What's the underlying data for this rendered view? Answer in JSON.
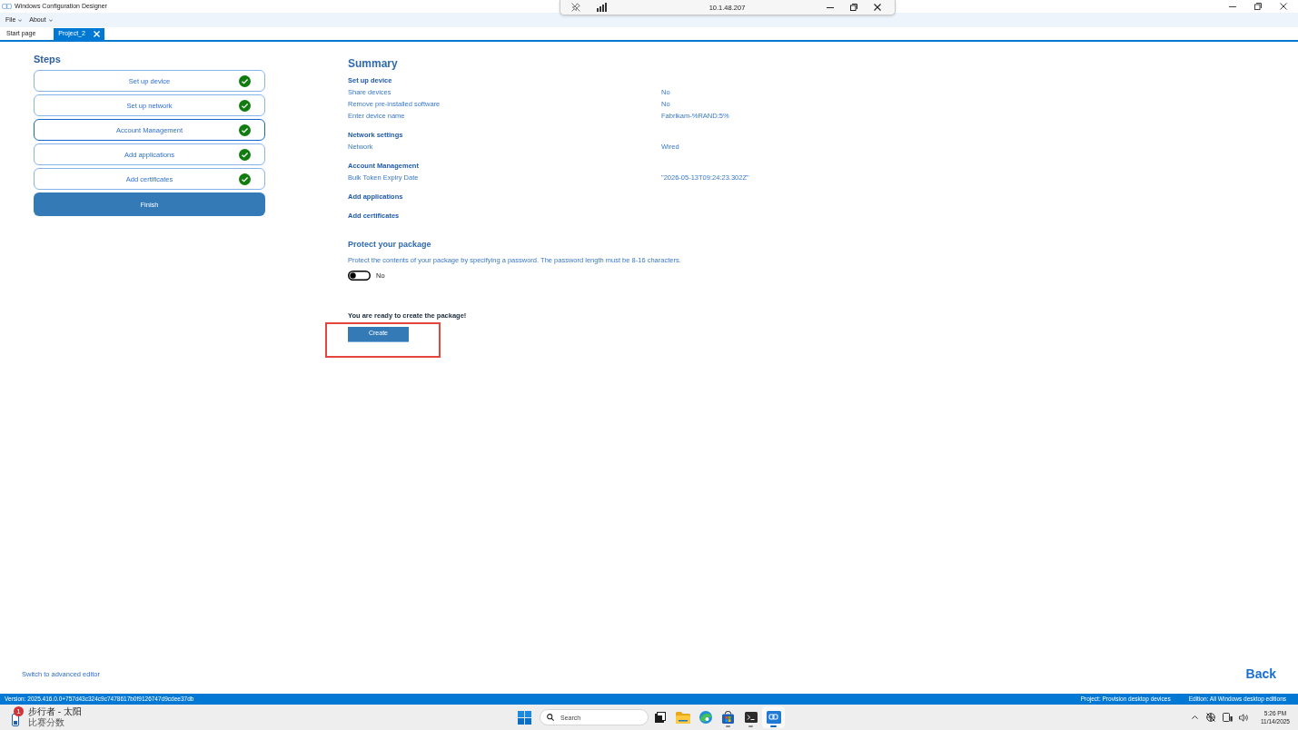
{
  "window": {
    "title": "Windows Configuration Designer"
  },
  "menu": [
    {
      "label": "File"
    },
    {
      "label": "About"
    }
  ],
  "tabs": [
    {
      "label": "Start page",
      "selected": false
    },
    {
      "label": "Project_2",
      "selected": true
    }
  ],
  "remote_bar": {
    "address": "10.1.48.207"
  },
  "steps": {
    "title": "Steps",
    "items": [
      {
        "label": "Set up device",
        "done": true,
        "focused": false
      },
      {
        "label": "Set up network",
        "done": true,
        "focused": false
      },
      {
        "label": "Account Management",
        "done": true,
        "focused": true
      },
      {
        "label": "Add applications",
        "done": true,
        "focused": false
      },
      {
        "label": "Add certificates",
        "done": true,
        "focused": false
      }
    ],
    "finish": "Finish"
  },
  "summary": {
    "title": "Summary",
    "sections": [
      {
        "heading": "Set up device",
        "rows": [
          {
            "label": "Share devices",
            "value": "No"
          },
          {
            "label": "Remove pre-installed software",
            "value": "No"
          },
          {
            "label": "Enter device name",
            "value": "Fabrikam-%RAND:5%"
          }
        ]
      },
      {
        "heading": "Network settings",
        "rows": [
          {
            "label": "Network",
            "value": "Wired"
          }
        ]
      },
      {
        "heading": "Account Management",
        "rows": [
          {
            "label": "Bulk Token Expiry Date",
            "value": "\"2026-05-13T09:24:23.302Z\""
          }
        ]
      },
      {
        "heading": "Add applications"
      },
      {
        "heading": "Add certificates"
      }
    ]
  },
  "protect": {
    "title": "Protect your package",
    "description": "Protect the contents of your package by specifying a password. The password length must be 8-16 characters.",
    "toggle": {
      "on": false,
      "label": "No"
    }
  },
  "ready": {
    "message": "You are ready to create the package!",
    "button": "Create"
  },
  "footer": {
    "link": "Switch to advanced editor",
    "back": "Back"
  },
  "status_bar": {
    "version": "Version: 2025.416.0.0+757d43c324c9c7478617b0f9126747d9cdee37db",
    "project": "Project: Provision desktop devices",
    "edition": "Edition: All Windows desktop editions"
  },
  "taskbar": {
    "widget": {
      "badge": "1",
      "title": "步行者 - 太阳",
      "subtitle": "比赛分数"
    },
    "search": {
      "placeholder": "Search"
    },
    "apps": [
      {
        "kind": "task-view",
        "running": false,
        "active": false
      },
      {
        "kind": "file-explorer",
        "running": false,
        "active": false
      },
      {
        "kind": "browser",
        "running": false,
        "active": false
      },
      {
        "kind": "store",
        "running": true,
        "active": false
      },
      {
        "kind": "terminal",
        "running": true,
        "active": false
      },
      {
        "kind": "config-designer",
        "running": true,
        "active": true
      }
    ],
    "clock": {
      "time": "5:26 PM",
      "date": "11/14/2025"
    }
  }
}
